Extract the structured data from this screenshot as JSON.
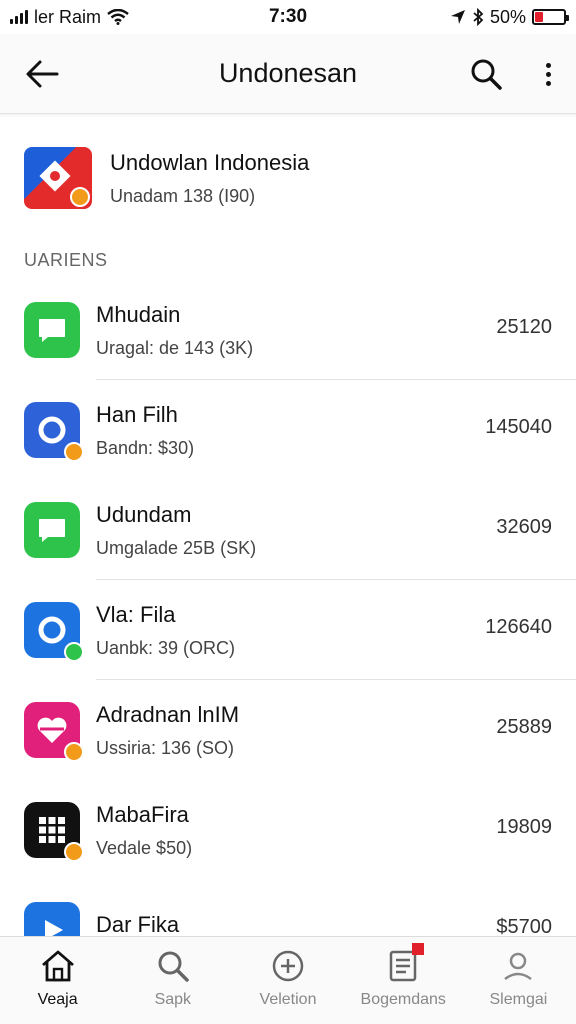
{
  "status": {
    "carrier": "ler Raim",
    "time": "7:30",
    "battery": "50%",
    "battery_level": 0.3,
    "battery_color": "#e0202a"
  },
  "header": {
    "title": "Undonesan"
  },
  "featured": {
    "name": "Undowlan Indonesia",
    "sub": "Unadam 138 (I90)"
  },
  "section_label": "UARIENS",
  "list": [
    {
      "name": "Mhudain",
      "sub": "Uragal: de 143 (3K)",
      "count": "25120",
      "icon_color": "#2ec34a",
      "badge_color": "",
      "icon": "chat-icon"
    },
    {
      "name": "Han Filh",
      "sub": "Bandn: $30)",
      "count": "145040",
      "icon_color": "#2d62d8",
      "badge_color": "#f29a1a",
      "icon": "ring-icon"
    },
    {
      "name": "Udundam",
      "sub": "Umgalade 25B (SK)",
      "count": "32609",
      "icon_color": "#2ec34a",
      "badge_color": "",
      "icon": "chat-icon"
    },
    {
      "name": "Vla: Fila",
      "sub": "Uanbk: 39 (ORC)",
      "count": "126640",
      "icon_color": "#1d73e0",
      "badge_color": "#2ec34a",
      "icon": "ring-icon"
    },
    {
      "name": "Adradnan lnIM",
      "sub": "Ussiria: 136 (SO)",
      "count": "25889",
      "icon_color": "#e0207a",
      "badge_color": "#f29a1a",
      "icon": "heart-icon"
    },
    {
      "name": "MabaFira",
      "sub": "Vedale $50)",
      "count": "19809",
      "icon_color": "#111111",
      "badge_color": "#f29a1a",
      "icon": "grid-icon"
    },
    {
      "name": "Dar Fika",
      "sub": "",
      "count": "$5700",
      "icon_color": "#1d73e0",
      "badge_color": "",
      "icon": "play-icon"
    }
  ],
  "nav": [
    {
      "label": "Veaja",
      "icon": "home-icon",
      "active": true
    },
    {
      "label": "Sapk",
      "icon": "search-icon",
      "active": false
    },
    {
      "label": "Veletion",
      "icon": "add-icon",
      "active": false
    },
    {
      "label": "Bogemdans",
      "icon": "document-icon",
      "active": false
    },
    {
      "label": "Slemgai",
      "icon": "profile-icon",
      "active": false
    }
  ]
}
